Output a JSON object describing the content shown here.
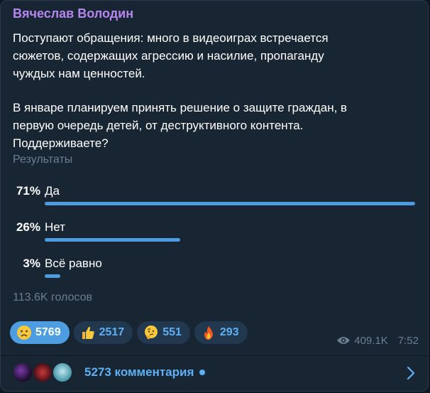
{
  "post": {
    "author": "Вячеслав Володин",
    "text_lines": [
      "Поступают обращения: много в видеоиграх встречается",
      "сюжетов, содержащих агрессию и насилие, пропаганду",
      "чуждых нам ценностей.",
      "В январе планируем принять решение о защите граждан, в",
      "первую очередь детей, от деструктивного контента.",
      "Поддерживаете?"
    ]
  },
  "poll": {
    "results_label": "Результаты",
    "options": [
      {
        "percent_label": "71%",
        "text": "Да",
        "fraction": 0.71
      },
      {
        "percent_label": "26%",
        "text": "Нет",
        "fraction": 0.26
      },
      {
        "percent_label": "3%",
        "text": "Всё равно",
        "fraction": 0.03
      }
    ],
    "votes_label": "113.6K голосов",
    "bar_color": "#4d9de0"
  },
  "reactions": [
    {
      "icon": "crying-face-icon",
      "count": "5769",
      "active": true
    },
    {
      "icon": "thumbs-up-icon",
      "count": "2517",
      "active": false
    },
    {
      "icon": "thinking-face-icon",
      "count": "551",
      "active": false
    },
    {
      "icon": "fire-icon",
      "count": "293",
      "active": false
    }
  ],
  "meta": {
    "views": "409.1K",
    "time": "7:52"
  },
  "comments": {
    "label": "5273 комментария",
    "unread_dot": true
  },
  "colors": {
    "background": "#0e1621",
    "bubble": "#182533",
    "author": "#b586ef",
    "accent": "#5fb0f4",
    "muted": "#6d7f8f"
  }
}
